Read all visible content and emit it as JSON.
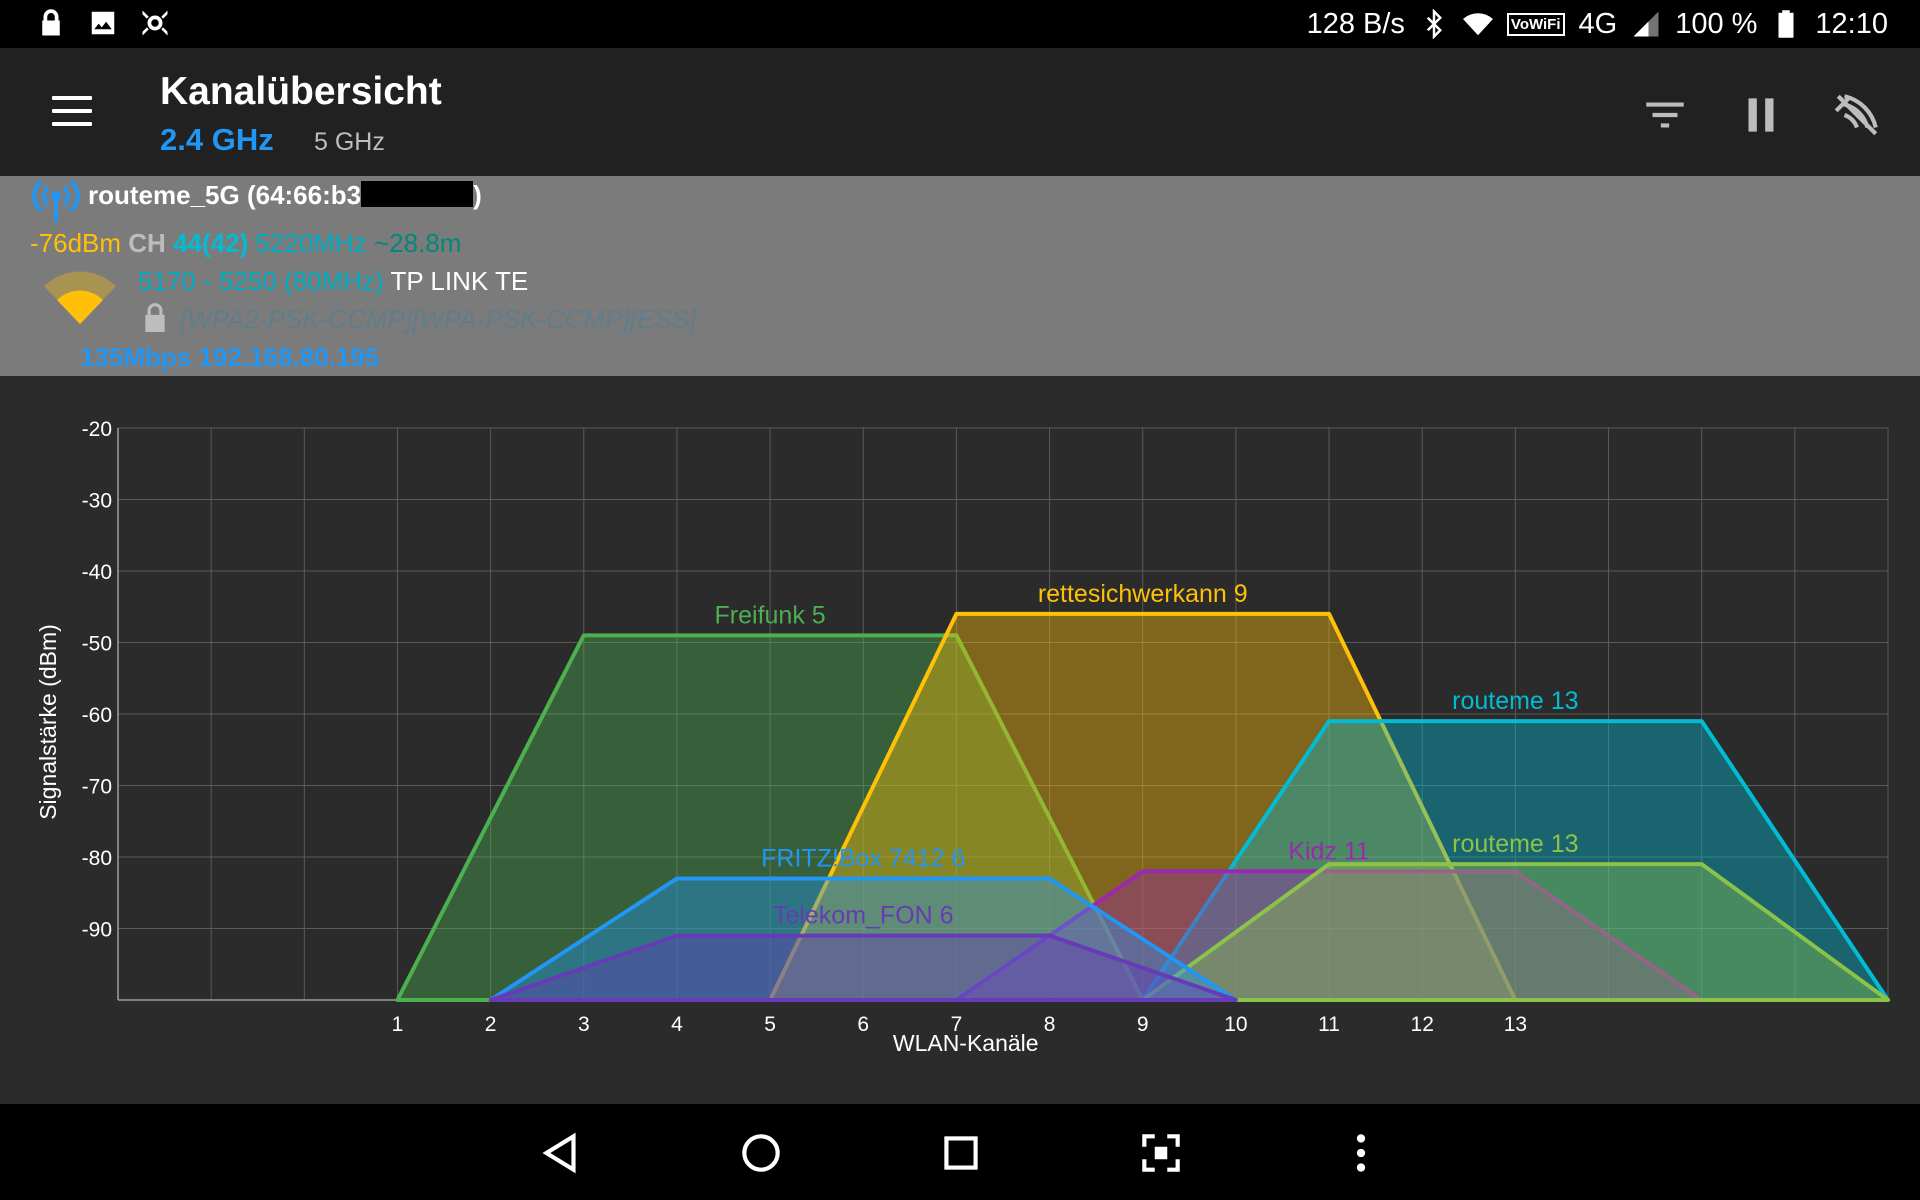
{
  "status_bar": {
    "left_icons": [
      "lock-icon",
      "image-icon",
      "bug-icon"
    ],
    "net_speed": "128 B/s",
    "vowifi": "VoWiFi",
    "network_type": "4G",
    "battery": "100 %",
    "time": "12:10"
  },
  "app_bar": {
    "title": "Kanalübersicht",
    "bands": [
      "2.4 GHz",
      "5 GHz"
    ],
    "active_band": "2.4 GHz",
    "actions": [
      "filter-icon",
      "pause-icon",
      "wifi-scan-icon"
    ]
  },
  "connection": {
    "ssid": "routeme_5G (64:66:b3",
    "ssid_suffix": ")",
    "signal": "-76dBm",
    "ch_label": "CH",
    "channel": "44(42)",
    "frequency": "5220MHz",
    "distance": "~28.8m",
    "range": "5170 - 5250 (80MHz)",
    "vendor": "TP LINK TE",
    "security": "[WPA2-PSK-CCMP][WPA-PSK-CCMP][ESS]",
    "link": "135Mbps 192.168.80.195"
  },
  "chart_data": {
    "type": "area",
    "ylabel": "Signalstärke (dBm)",
    "xlabel": "WLAN-Kanäle",
    "ylim": [
      -100,
      -20
    ],
    "yticks": [
      -20,
      -30,
      -40,
      -50,
      -60,
      -70,
      -80,
      -90
    ],
    "xticks": [
      1,
      2,
      3,
      4,
      5,
      6,
      7,
      8,
      9,
      10,
      11,
      12,
      13
    ],
    "xlim": [
      -2,
      17
    ],
    "grid": true,
    "series": [
      {
        "name": "Freifunk 5",
        "channel": 5,
        "level": -49,
        "color": "#4caf50"
      },
      {
        "name": "rettesichwerkann 9",
        "channel": 9,
        "level": -46,
        "color": "#ffc107"
      },
      {
        "name": "routeme 13",
        "channel": 13,
        "level": -61,
        "color": "#00bcd4"
      },
      {
        "name": "Kidz 11",
        "channel": 11,
        "level": -82,
        "color": "#9c27b0"
      },
      {
        "name": "routeme 13",
        "channel": 13,
        "level": -81,
        "color": "#8bc34a"
      },
      {
        "name": "FRITZ!Box 7412 6",
        "channel": 6,
        "level": -83,
        "color": "#2196f3"
      },
      {
        "name": "Telekom_FON 6",
        "channel": 6,
        "level": -91,
        "color": "#673ab7"
      }
    ]
  },
  "nav_bar": [
    "back-icon",
    "home-icon",
    "recents-icon",
    "screenshot-icon",
    "more-icon"
  ]
}
